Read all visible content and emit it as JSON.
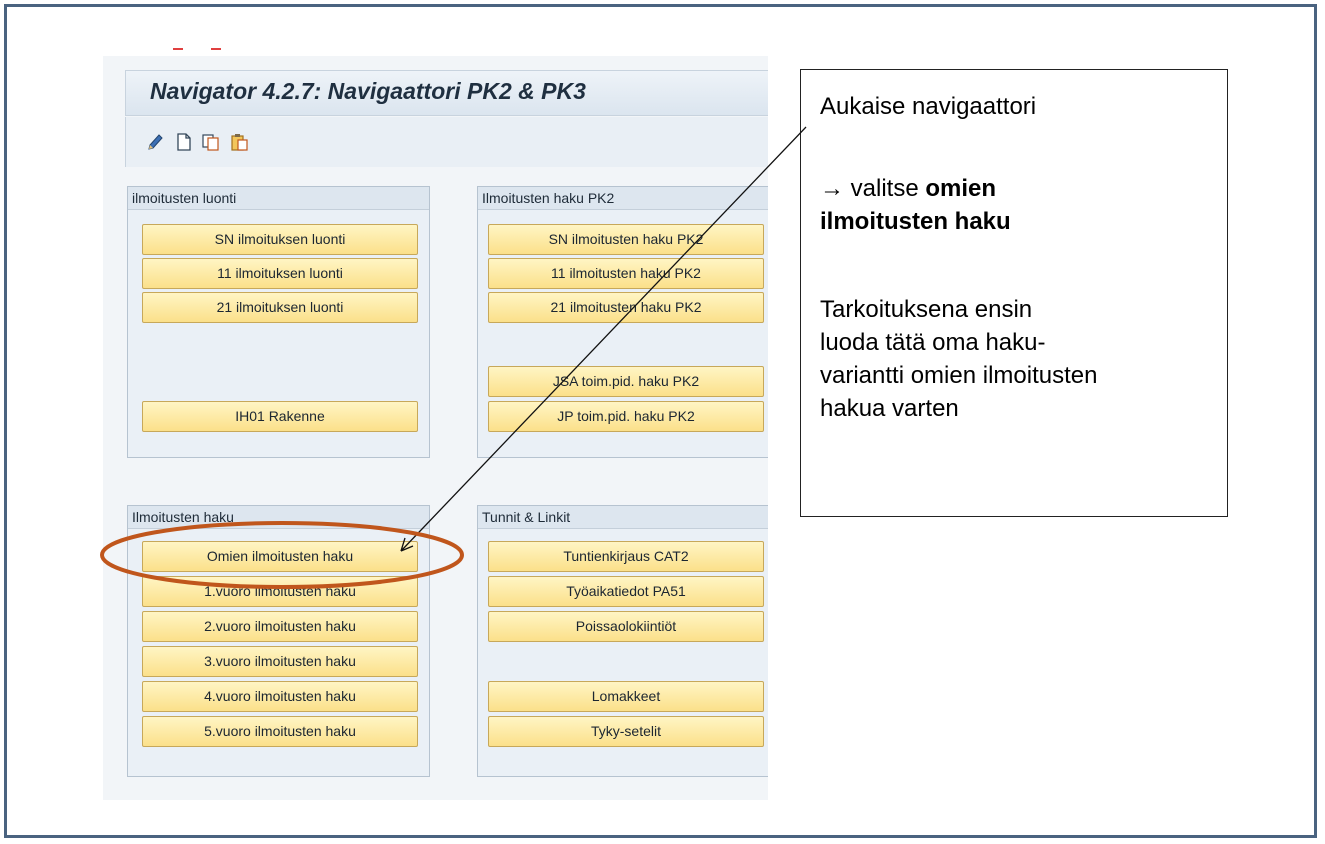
{
  "window": {
    "title": "Navigator 4.2.7: Navigaattori PK2 & PK3",
    "toolbar_icons": [
      "pencil-icon",
      "new-document-icon",
      "copy-icon",
      "paste-icon"
    ]
  },
  "groups": {
    "luonti": {
      "title": "ilmoitusten luonti",
      "buttons": [
        "SN ilmoituksen luonti",
        "11 ilmoituksen luonti",
        "21 ilmoituksen luonti",
        "IH01 Rakenne"
      ]
    },
    "haku_pk2": {
      "title": "Ilmoitusten haku PK2",
      "buttons": [
        "SN ilmoitusten haku PK2",
        "11 ilmoitusten haku PK2",
        "21 ilmoitusten haku PK2",
        "JSA toim.pid. haku PK2",
        "JP toim.pid. haku PK2"
      ]
    },
    "haku": {
      "title": "Ilmoitusten haku",
      "buttons": [
        "Omien ilmoitusten haku",
        "1.vuoro ilmoitusten haku",
        "2.vuoro ilmoitusten haku",
        "3.vuoro ilmoitusten haku",
        "4.vuoro ilmoitusten haku",
        "5.vuoro ilmoitusten haku"
      ]
    },
    "tunnit": {
      "title": "Tunnit & Linkit",
      "buttons": [
        "Tuntienkirjaus CAT2",
        "Työaikatiedot PA51",
        "Poissaolokiintiöt",
        "Lomakkeet",
        "Tyky-setelit"
      ]
    }
  },
  "callout": {
    "line1": "Aukaise navigaattori",
    "arrow": "→",
    "line2_prefix": "valitse",
    "line2_bold_a": "omien",
    "line2_bold_b": "ilmoitusten haku",
    "para_lines": [
      "Tarkoituksena ensin",
      "luoda tätä oma haku-",
      "variantti omien ilmoitusten",
      "hakua varten"
    ]
  },
  "colors": {
    "frame_border": "#4a6380",
    "highlight_ellipse": "#c0561c",
    "button_fill": "#fbe08a",
    "button_border": "#c7a85a"
  }
}
